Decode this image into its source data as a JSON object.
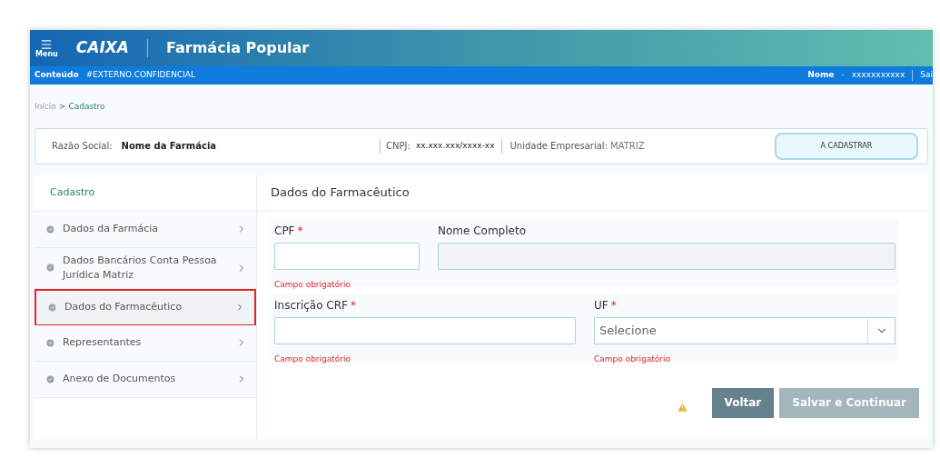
{
  "header": {
    "menu_label": "Menu",
    "logo": "CAIXA",
    "title": "Farmácia Popular"
  },
  "subbar": {
    "content_label": "Conteúdo",
    "classification": "#EXTERNO.CONFIDENCIAL",
    "user_label": "Nome",
    "separator": "-",
    "user_value": "xxxxxxxxxxx",
    "exit": "Sai"
  },
  "breadcrumb": {
    "separator": ">",
    "items": [
      {
        "label": "Início",
        "selected": false
      },
      {
        "label": "Cadastro",
        "selected": true
      }
    ]
  },
  "info": {
    "company_label": "Razão Social:",
    "company_value": "Nome da Farmácia",
    "cnpj_label": "CNPJ:",
    "cnpj_value": "xx.xxx.xxx/xxxx-xx",
    "unit_label": "Unidade Empresarial:",
    "unit_value": "MATRIZ",
    "status": "A CADASTRAR"
  },
  "sidebar": {
    "title": "Cadastro",
    "items": [
      {
        "label": "Dados da Farmácia",
        "selected": false
      },
      {
        "label": "Dados Bancários Conta Pessoa Jurídica Matriz",
        "selected": false
      },
      {
        "label": "Dados do Farmacêutico",
        "selected": true
      },
      {
        "label": "Representantes",
        "selected": false
      },
      {
        "label": "Anexo de Documentos",
        "selected": false
      }
    ]
  },
  "form": {
    "title": "Dados do Farmacêutico",
    "rows": [
      [
        {
          "kind": "short_text",
          "label": "CPF",
          "required_mark": "*",
          "error": "Campo obrigatório",
          "disabled": false
        },
        {
          "kind": "text",
          "label": "Nome Completo",
          "disabled": true
        }
      ],
      [
        {
          "kind": "text",
          "label": "Inscrição CRF",
          "required_mark": "*",
          "error": "Campo obrigatório",
          "disabled": false
        },
        {
          "kind": "select",
          "label": "UF",
          "required_mark": "*",
          "placeholder": "Selecione",
          "error": "Campo obrigatório"
        }
      ]
    ]
  },
  "buttons": [
    {
      "label": "Voltar",
      "disabled": false
    },
    {
      "label": "Salvar e Continuar",
      "disabled": true
    }
  ]
}
